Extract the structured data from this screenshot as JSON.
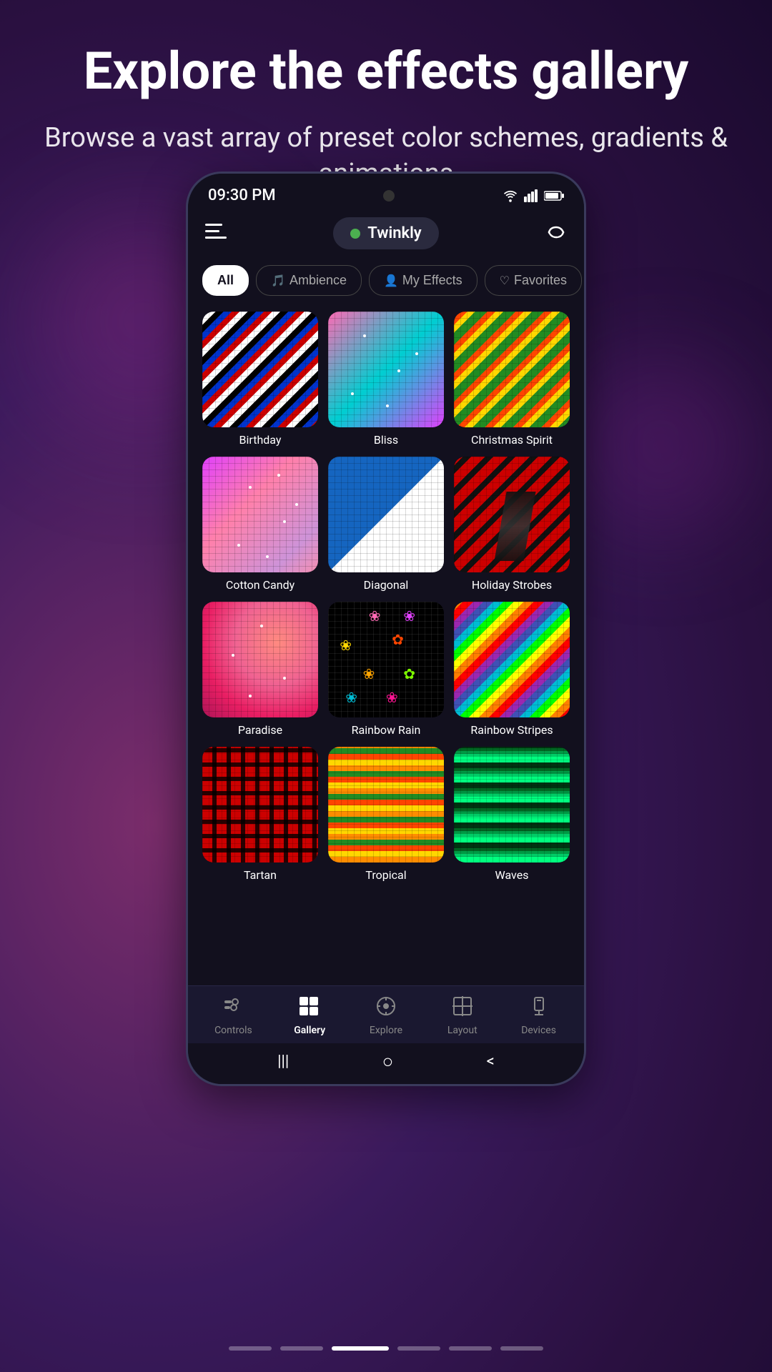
{
  "page": {
    "title": "Explore the effects gallery",
    "subtitle": "Browse a vast array of preset color schemes, gradients & animations"
  },
  "status_bar": {
    "time": "09:30 PM",
    "wifi_icon": "wifi",
    "signal_icon": "signal",
    "battery_icon": "battery"
  },
  "top_nav": {
    "brand": "Twinkly",
    "menu_icon": "menu",
    "loading_icon": "loading"
  },
  "filter_tabs": [
    {
      "id": "all",
      "label": "All",
      "active": true,
      "icon": ""
    },
    {
      "id": "ambience",
      "label": "Ambience",
      "active": false,
      "icon": "🎵"
    },
    {
      "id": "my-effects",
      "label": "My Effects",
      "active": false,
      "icon": "👤"
    },
    {
      "id": "favorites",
      "label": "Favorites",
      "active": false,
      "icon": "♡"
    }
  ],
  "effects": [
    {
      "id": "birthday",
      "name": "Birthday",
      "thumb": "birthday"
    },
    {
      "id": "bliss",
      "name": "Bliss",
      "thumb": "bliss"
    },
    {
      "id": "christmas-spirit",
      "name": "Christmas Spirit",
      "thumb": "christmas"
    },
    {
      "id": "cotton-candy",
      "name": "Cotton Candy",
      "thumb": "cotton-candy"
    },
    {
      "id": "diagonal",
      "name": "Diagonal",
      "thumb": "diagonal"
    },
    {
      "id": "holiday-strobes",
      "name": "Holiday Strobes",
      "thumb": "holiday"
    },
    {
      "id": "paradise",
      "name": "Paradise",
      "thumb": "paradise"
    },
    {
      "id": "rainbow-rain",
      "name": "Rainbow Rain",
      "thumb": "rainbow-rain"
    },
    {
      "id": "rainbow-stripes",
      "name": "Rainbow Stripes",
      "thumb": "rainbow-stripes"
    },
    {
      "id": "tartan",
      "name": "Tartan",
      "thumb": "tartan"
    },
    {
      "id": "tropical",
      "name": "Tropical",
      "thumb": "tropical"
    },
    {
      "id": "waves",
      "name": "Waves",
      "thumb": "waves"
    }
  ],
  "bottom_nav": [
    {
      "id": "controls",
      "label": "Controls",
      "icon": "⊞",
      "active": false
    },
    {
      "id": "gallery",
      "label": "Gallery",
      "icon": "⊟",
      "active": true
    },
    {
      "id": "explore",
      "label": "Explore",
      "icon": "⊙",
      "active": false
    },
    {
      "id": "layout",
      "label": "Layout",
      "icon": "#",
      "active": false
    },
    {
      "id": "devices",
      "label": "Devices",
      "icon": "⊠",
      "active": false
    }
  ],
  "system_nav": {
    "recent": "|||",
    "home": "○",
    "back": "<"
  }
}
